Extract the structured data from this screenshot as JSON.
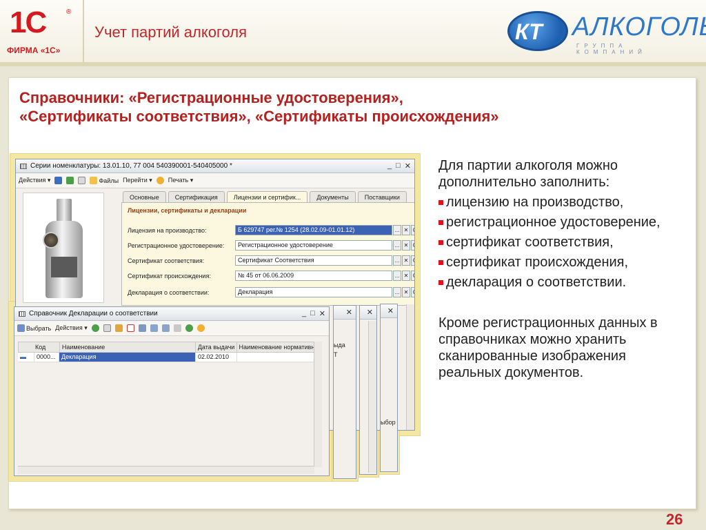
{
  "header": {
    "logo_1c": "1С",
    "logo_firm": "ФИРМА «1С»",
    "title": "Учет партий алкоголя",
    "kt_mark": "КТ",
    "kt_name": "АЛКОГОЛЬ",
    "kt_sub": "ГРУППА КОМПАНИЙ"
  },
  "slide": {
    "title_line1": "Справочники: «Регистрационные удостоверения»,",
    "title_line2": "«Сертификаты соответствия», «Сертификаты происхождения»",
    "page_number": "26"
  },
  "right_text": {
    "intro": "Для партии алкоголя можно дополнительно заполнить:",
    "bullets": [
      "лицензию на производство,",
      " регистрационное удостоверение,",
      " сертификат соответствия,",
      " сертификат происхождения,",
      "декларация о соответствии."
    ],
    "outro": "Кроме регистрационных данных в справочниках можно хранить сканированные изображения реальных документов."
  },
  "main_window": {
    "title": "Серии номенклатуры: 13.01.10, 77 004 540390001-540405000 *",
    "controls": [
      "_",
      "□",
      "✕"
    ],
    "toolbar": {
      "actions": "Действия ▾",
      "files": "Файлы",
      "go": "Перейти ▾",
      "print": "Печать ▾"
    },
    "tabs": [
      "Основные",
      "Сертификация",
      "Лицензии и сертифик...",
      "Документы",
      "Поставщики"
    ],
    "panel_heading": "Лицензии, сертификаты и декларации",
    "fields": [
      {
        "label": "Лицензия на производство:",
        "value": "Б 629747 рег.№ 1254 (28.02.09-01.01.12)"
      },
      {
        "label": "Регистрационное удостоверение:",
        "value": "Регистрационное удостоверение"
      },
      {
        "label": "Сертификат соответствия:",
        "value": "Сертификат Соответствия"
      },
      {
        "label": "Сертификат происхождения:",
        "value": "№ 45 от 06.06.2009"
      },
      {
        "label": "Декларация о соответствии:",
        "value": "Декларация"
      }
    ],
    "btn_select": "...",
    "btn_clear": "✕",
    "btn_search": "Q"
  },
  "decl_window": {
    "title": "Справочник Декларации о соответствии",
    "controls": [
      "_",
      "□",
      "✕"
    ],
    "toolbar": {
      "select": "Выбрать",
      "actions": "Действия ▾"
    },
    "columns": [
      "Код",
      "Наименование",
      "Дата выдачи",
      "Наименование нормативного"
    ],
    "rows": [
      {
        "code": "0000...",
        "name": "Декларация",
        "date": "02.02.2010",
        "norm": ""
      }
    ]
  },
  "back_windows": {
    "label_top": "ыда",
    "label_row": "Т",
    "label_bottom": "ыбор"
  }
}
